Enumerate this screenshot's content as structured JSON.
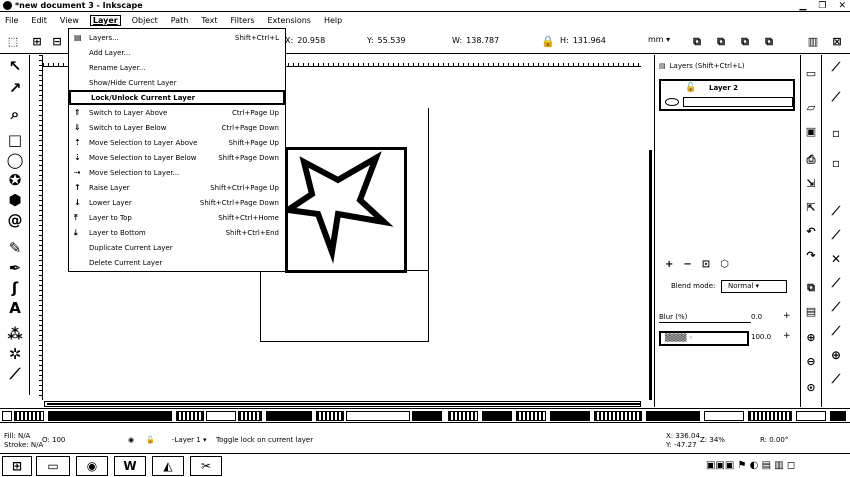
{
  "window": {
    "title": "*new document 3 - Inkscape",
    "minimize": "▁",
    "maximize": "❐",
    "close": "✕"
  },
  "menubar": [
    "File",
    "Edit",
    "View",
    "Layer",
    "Object",
    "Path",
    "Text",
    "Filters",
    "Extensions",
    "Help"
  ],
  "active_menu": "Layer",
  "toolbar": {
    "x_label": "X:",
    "x_value": "20.958",
    "y_label": "Y:",
    "y_value": "55.539",
    "w_label": "W:",
    "w_value": "138.787",
    "h_label": "H:",
    "h_value": "131.964",
    "unit": "mm"
  },
  "layer_menu": [
    {
      "label": "Layers...",
      "shortcut": "Shift+Ctrl+L",
      "icon": "layers-icon"
    },
    {
      "label": "Add Layer...",
      "shortcut": "",
      "icon": ""
    },
    {
      "label": "Rename Layer...",
      "shortcut": "",
      "icon": ""
    },
    {
      "label": "Show/Hide Current Layer",
      "shortcut": "",
      "icon": ""
    },
    {
      "label": "Lock/Unlock Current Layer",
      "shortcut": "",
      "icon": ""
    },
    {
      "label": "Switch to Layer Above",
      "shortcut": "Ctrl+Page Up",
      "icon": "layer-up-icon"
    },
    {
      "label": "Switch to Layer Below",
      "shortcut": "Ctrl+Page Down",
      "icon": "layer-down-icon"
    },
    {
      "label": "Move Selection to Layer Above",
      "shortcut": "Shift+Page Up",
      "icon": "move-up-icon"
    },
    {
      "label": "Move Selection to Layer Below",
      "shortcut": "Shift+Page Down",
      "icon": "move-down-icon"
    },
    {
      "label": "Move Selection to Layer...",
      "shortcut": "",
      "icon": "move-to-icon"
    },
    {
      "label": "Raise Layer",
      "shortcut": "Shift+Ctrl+Page Up",
      "icon": "raise-icon"
    },
    {
      "label": "Lower Layer",
      "shortcut": "Shift+Ctrl+Page Down",
      "icon": "lower-icon"
    },
    {
      "label": "Layer to Top",
      "shortcut": "Shift+Ctrl+Home",
      "icon": "top-icon"
    },
    {
      "label": "Layer to Bottom",
      "shortcut": "Shift+Ctrl+End",
      "icon": "bottom-icon"
    },
    {
      "label": "Duplicate Current Layer",
      "shortcut": "",
      "icon": ""
    },
    {
      "label": "Delete Current Layer",
      "shortcut": "",
      "icon": ""
    }
  ],
  "highlighted_menu_item": "Lock/Unlock Current Layer",
  "layers_panel": {
    "title": "Layers (Shift+Ctrl+L)",
    "layer_name": "Layer 2",
    "blend_label": "Blend mode:",
    "blend_value": "Normal",
    "blur_label": "Blur (%)",
    "blur_value": "0.0",
    "opacity_value": "100.0"
  },
  "status": {
    "fill_label": "Fill:",
    "fill_value": "N/A",
    "stroke_label": "Stroke:",
    "stroke_value": "N/A",
    "opacity_label": "O:",
    "opacity_value": "100",
    "layer_select": "-Layer 1",
    "message": "Toggle lock on current layer",
    "x_label": "X:",
    "x_value": "336.04",
    "y_label": "Y:",
    "y_value": "-47.27",
    "zoom_label": "Z:",
    "zoom_value": "34%",
    "rotate_label": "R:",
    "rotate_value": "0.00°"
  }
}
